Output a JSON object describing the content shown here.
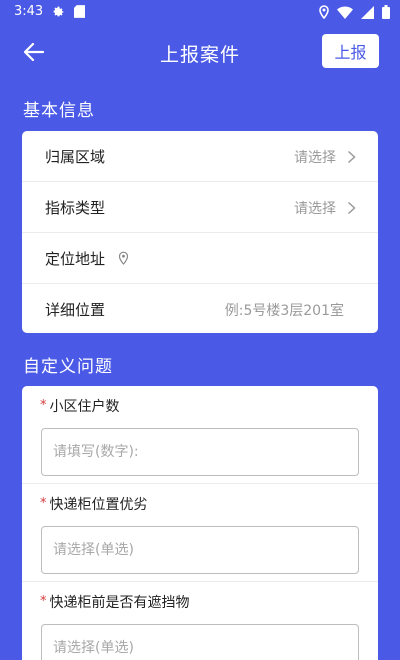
{
  "status_bar": {
    "time": "3:43",
    "icons": [
      "gear-icon",
      "sd-card-icon",
      "location-icon",
      "wifi-icon",
      "signal-icon",
      "battery-icon"
    ]
  },
  "header": {
    "title": "上报案件",
    "report_label": "上报"
  },
  "basic_info": {
    "section_title": "基本信息",
    "rows": [
      {
        "label": "归属区域",
        "value": "请选择"
      },
      {
        "label": "指标类型",
        "value": "请选择"
      },
      {
        "label": "定位地址",
        "value": ""
      },
      {
        "label": "详细位置",
        "value": "例:5号楼3层201室"
      }
    ]
  },
  "custom_questions": {
    "section_title": "自定义问题",
    "required_mark": "*",
    "items": [
      {
        "label": "小区住户数",
        "placeholder": "请填写(数字):"
      },
      {
        "label": "快递柜位置优劣",
        "placeholder": "请选择(单选)"
      },
      {
        "label": "快递柜前是否有遮挡物",
        "placeholder": "请选择(单选)"
      }
    ]
  },
  "colors": {
    "primary": "#4a5ae6",
    "card": "#ffffff",
    "required": "#d23a3a",
    "hint": "#9a9a9a"
  }
}
